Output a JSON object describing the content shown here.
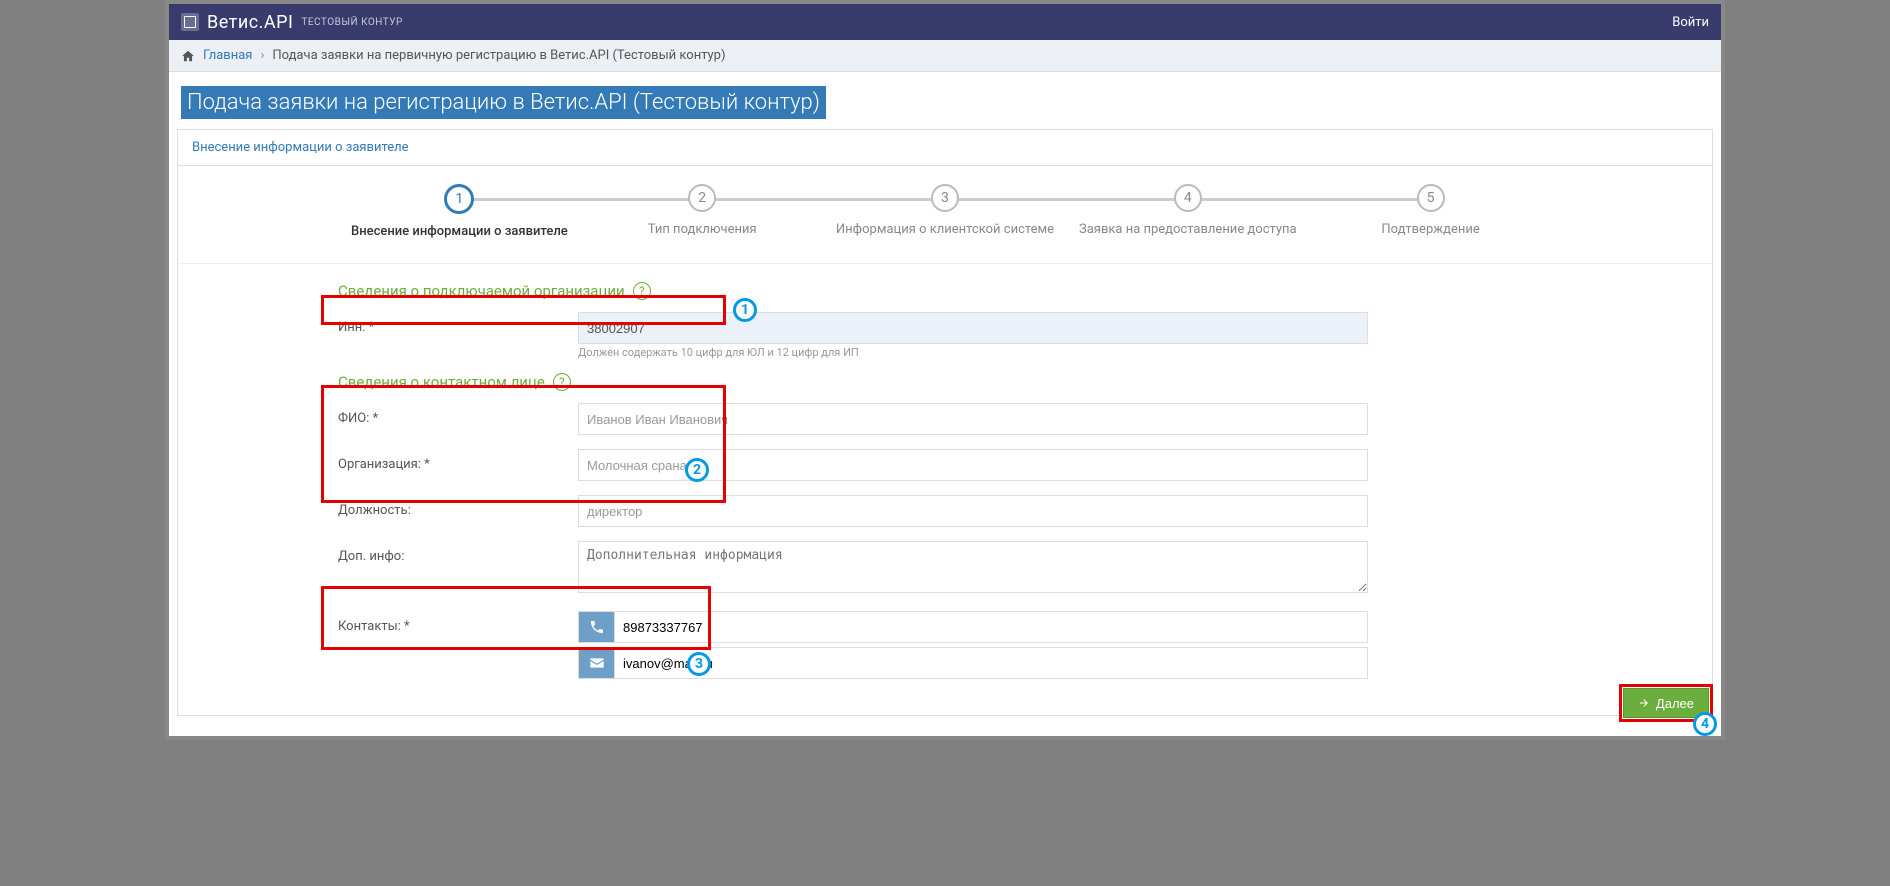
{
  "navbar": {
    "title": "Ветис.API",
    "badge": "ТЕСТОВЫЙ КОНТУР",
    "login": "Войти"
  },
  "breadcrumb": {
    "home": "Главная",
    "current": "Подача заявки на первичную регистрацию в Ветис.API (Тестовый контур)"
  },
  "page_title": "Подача заявки на регистрацию в Ветис.API (Тестовый контур)",
  "panel_header": "Внесение информации о заявителе",
  "stepper": [
    {
      "num": "1",
      "label": "Внесение информации о заявителе",
      "active": true
    },
    {
      "num": "2",
      "label": "Тип подключения",
      "active": false
    },
    {
      "num": "3",
      "label": "Информация о клиентской системе",
      "active": false
    },
    {
      "num": "4",
      "label": "Заявка на предоставление доступа",
      "active": false
    },
    {
      "num": "5",
      "label": "Подтверждение",
      "active": false
    }
  ],
  "section_org": {
    "title": "Сведения о подключаемой организации"
  },
  "section_contact": {
    "title": "Сведения о контактном лице"
  },
  "fields": {
    "inn": {
      "label": "Инн: *",
      "value": "38002907",
      "hint": "Должен содержать 10 цифр для ЮЛ и 12 цифр для ИП"
    },
    "fio": {
      "label": "ФИО: *",
      "placeholder": "Иванов Иван Иванович"
    },
    "org": {
      "label": "Организация: *",
      "placeholder": "Молочная срана"
    },
    "position": {
      "label": "Должность:",
      "placeholder": "директор"
    },
    "extra": {
      "label": "Доп. инфо:",
      "placeholder": "Дополнительная информация"
    },
    "contacts": {
      "label": "Контакты: *",
      "phone": "89873337767",
      "email": "ivanov@mail.ru"
    }
  },
  "next_button": "Далее",
  "annotations": {
    "marker1": "1",
    "marker2": "2",
    "marker3": "3",
    "marker4": "4"
  }
}
